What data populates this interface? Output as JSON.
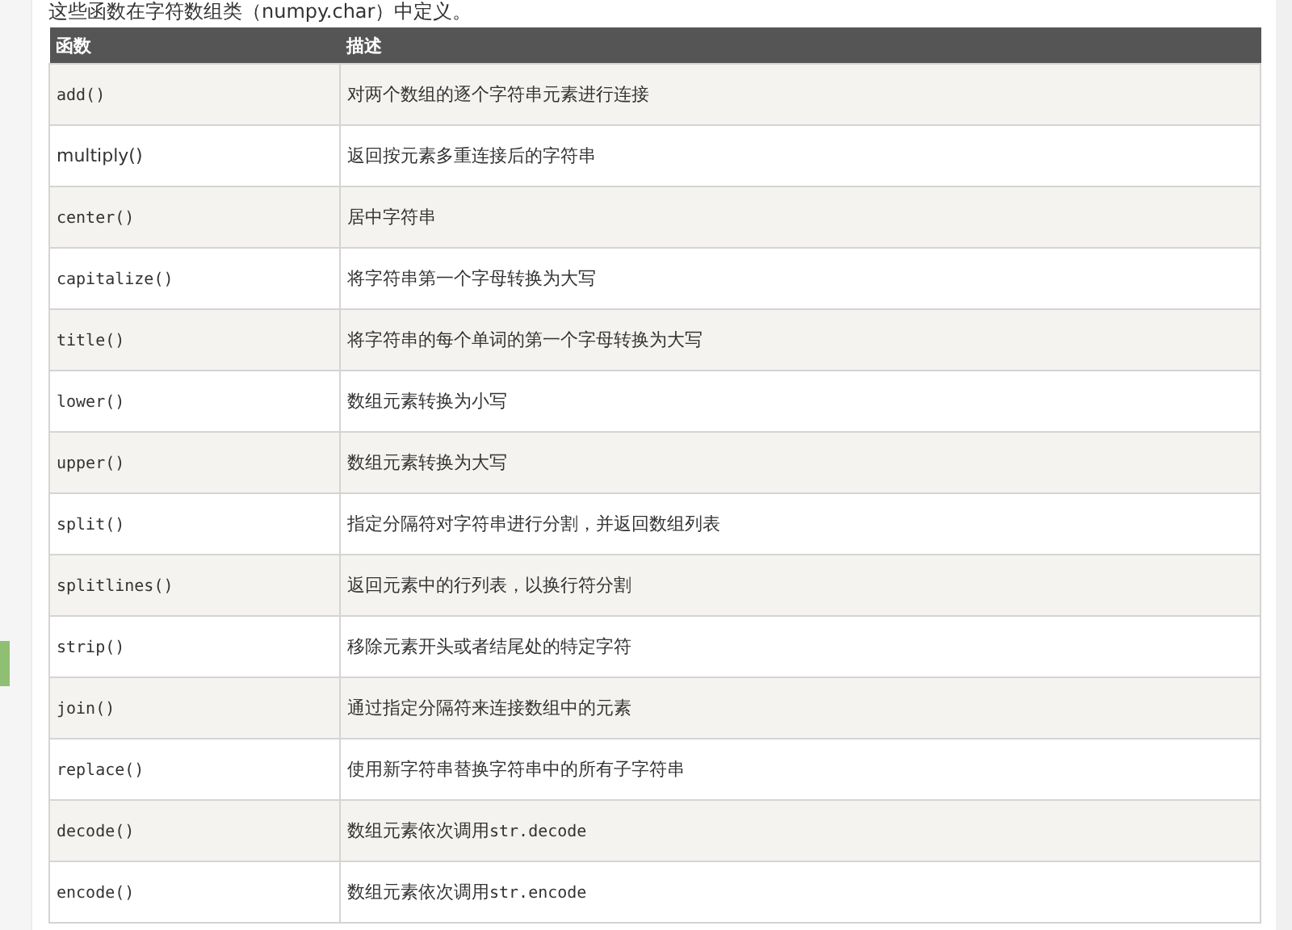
{
  "intro": "这些函数在字符数组类（numpy.char）中定义。",
  "table": {
    "columns": [
      "函数",
      "描述"
    ],
    "rows": [
      {
        "function": "add()",
        "kind": "code",
        "description": "对两个数组的逐个字符串元素进行连接"
      },
      {
        "function": "multiply()",
        "kind": "plain",
        "description": "返回按元素多重连接后的字符串"
      },
      {
        "function": "center()",
        "kind": "code",
        "description": "居中字符串"
      },
      {
        "function": "capitalize()",
        "kind": "code",
        "description": "将字符串第一个字母转换为大写"
      },
      {
        "function": "title()",
        "kind": "code",
        "description": "将字符串的每个单词的第一个字母转换为大写"
      },
      {
        "function": "lower()",
        "kind": "code",
        "description": "数组元素转换为小写"
      },
      {
        "function": "upper()",
        "kind": "code",
        "description": "数组元素转换为大写"
      },
      {
        "function": "split()",
        "kind": "code",
        "description": "指定分隔符对字符串进行分割，并返回数组列表"
      },
      {
        "function": "splitlines()",
        "kind": "code",
        "description": "返回元素中的行列表，以换行符分割"
      },
      {
        "function": "strip()",
        "kind": "code",
        "description": "移除元素开头或者结尾处的特定字符"
      },
      {
        "function": "join()",
        "kind": "code",
        "description": "通过指定分隔符来连接数组中的元素"
      },
      {
        "function": "replace()",
        "kind": "code",
        "description": "使用新字符串替换字符串中的所有子字符串"
      },
      {
        "function": "decode()",
        "kind": "code",
        "description": "数组元素依次调用",
        "description_code": "str.decode"
      },
      {
        "function": "encode()",
        "kind": "code",
        "description": "数组元素依次调用",
        "description_code": "str.encode"
      }
    ]
  }
}
